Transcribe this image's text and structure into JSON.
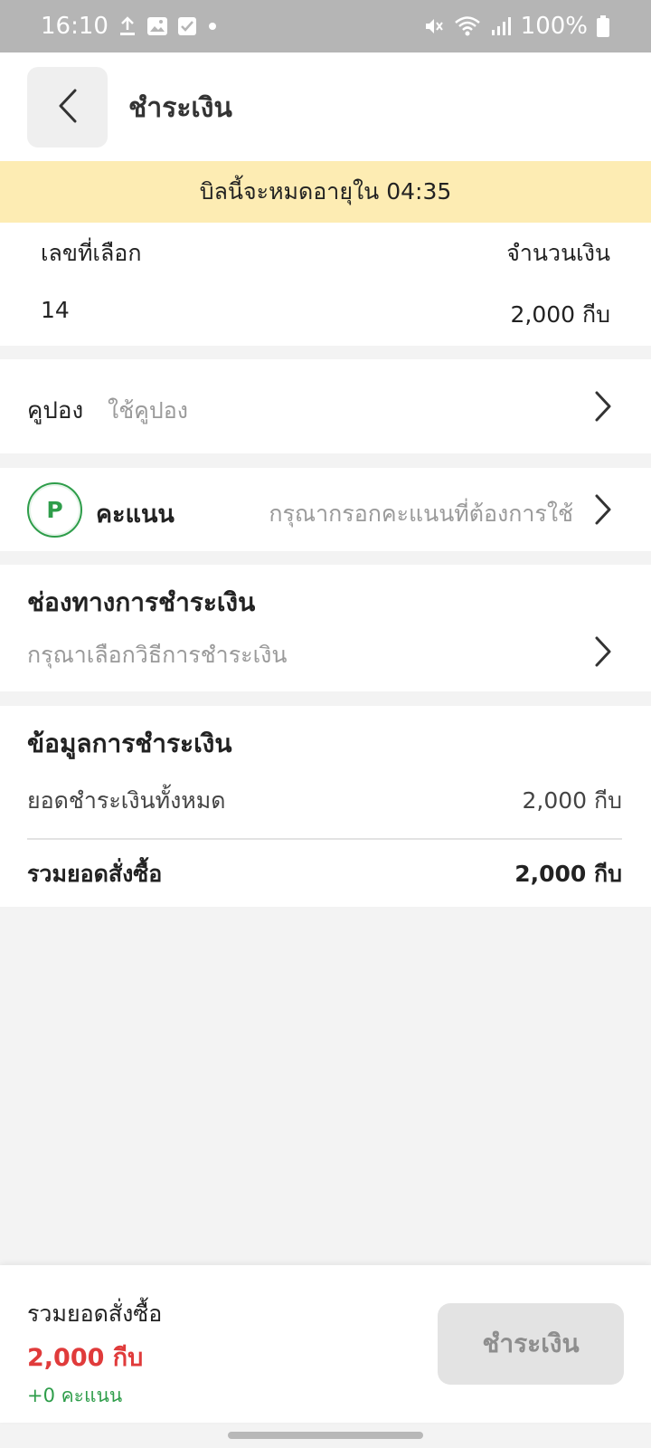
{
  "status_bar": {
    "time": "16:10",
    "battery": "100%",
    "icons": [
      "upload-icon",
      "image-icon",
      "checkbox-icon",
      "dot-icon",
      "mute-icon",
      "wifi-icon",
      "signal-icon",
      "battery-icon"
    ]
  },
  "header": {
    "title": "ชำระเงิน"
  },
  "timer_banner": {
    "text": "บิลนี้จะหมดอายุใน 04:35"
  },
  "ticket": {
    "number_header": "เลขที่เลือก",
    "amount_header": "จำนวนเงิน",
    "number": "14",
    "amount": "2,000 กีบ"
  },
  "coupon": {
    "label": "คูปอง",
    "hint": "ใช้คูปอง"
  },
  "points": {
    "badge": "P",
    "label": "คะแนน",
    "hint": "กรุณากรอกคะแนนที่ต้องการใช้"
  },
  "payment_channel": {
    "title": "ช่องทางการชำระเงิน",
    "hint": "กรุณาเลือกวิธีการชำระเงิน"
  },
  "payment_info": {
    "title": "ข้อมูลการชำระเงิน",
    "subtotal_label": "ยอดชำระเงินทั้งหมด",
    "subtotal_value": "2,000 กีบ",
    "total_label": "รวมยอดสั่งซื้อ",
    "total_value": "2,000 กีบ"
  },
  "bottom_bar": {
    "label": "รวมยอดสั่งซื้อ",
    "amount": "2,000 กีบ",
    "points_earned": "+0 คะแนน",
    "pay_button": "ชำระเงิน"
  },
  "colors": {
    "banner": "#fdecb3",
    "accent_red": "#e03b3b",
    "accent_green": "#2e9d4a",
    "disabled_button": "#e3e3e3"
  }
}
